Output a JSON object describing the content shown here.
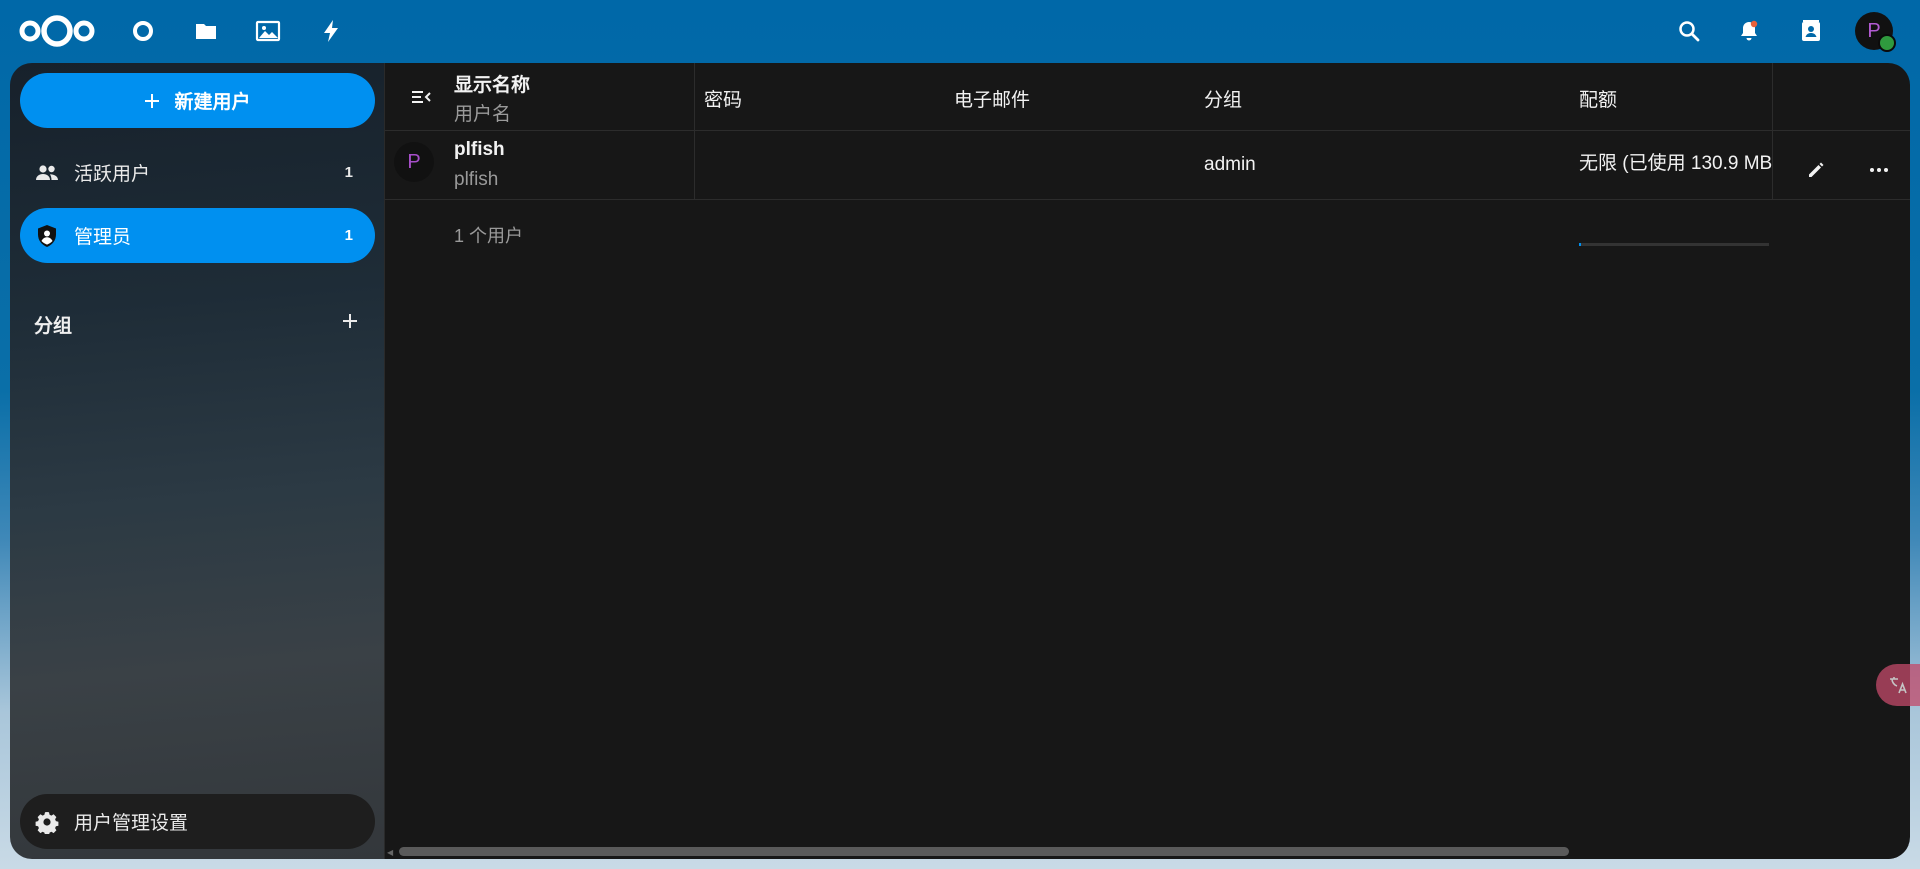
{
  "header": {
    "apps": [
      {
        "name": "dashboard",
        "icon": "dashboard-icon"
      },
      {
        "name": "files",
        "icon": "folder-icon"
      },
      {
        "name": "photos",
        "icon": "image-icon"
      },
      {
        "name": "activity",
        "icon": "lightning-icon"
      }
    ],
    "right_icons": [
      "search-icon",
      "notifications-icon",
      "contacts-icon"
    ],
    "avatar_initial": "P",
    "status_color": "#2f9a3e"
  },
  "sidebar": {
    "new_user_label": "新建用户",
    "items": [
      {
        "label": "活跃用户",
        "count": "1",
        "icon": "users-icon",
        "active": false
      },
      {
        "label": "管理员",
        "count": "1",
        "icon": "admin-shield-icon",
        "active": true
      }
    ],
    "groups_heading": "分组",
    "settings_label": "用户管理设置"
  },
  "table": {
    "columns": {
      "display_name": "显示名称",
      "username": "用户名",
      "password": "密码",
      "email": "电子邮件",
      "groups": "分组",
      "quota": "配额"
    },
    "rows": [
      {
        "avatar_initial": "P",
        "display_name": "plfish",
        "username": "plfish",
        "password": "",
        "email": "",
        "groups": "admin",
        "quota": "无限 (已使用 130.9 MB"
      }
    ],
    "footer": "1 个用户"
  },
  "colors": {
    "accent": "#0090f0",
    "header_bg": "#0068a8",
    "content_bg": "#171717"
  }
}
